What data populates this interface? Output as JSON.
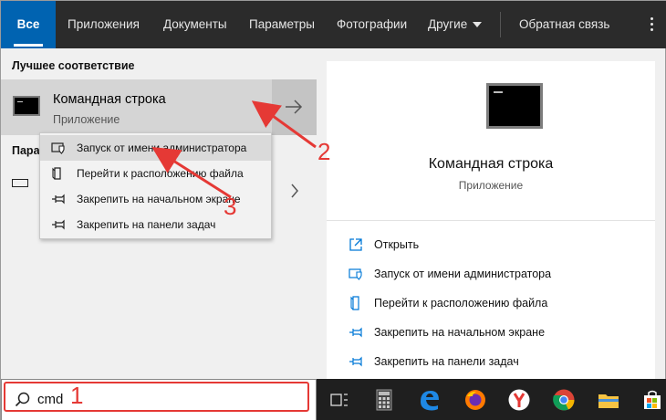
{
  "nav": {
    "tabs": [
      {
        "label": "Все"
      },
      {
        "label": "Приложения"
      },
      {
        "label": "Документы"
      },
      {
        "label": "Параметры"
      },
      {
        "label": "Фотографии"
      },
      {
        "label": "Другие"
      }
    ],
    "feedback": "Обратная связь"
  },
  "best_match": {
    "section_title": "Лучшее соответствие",
    "title": "Командная строка",
    "subtitle": "Приложение"
  },
  "partial_section_title": "Пара",
  "context_menu": {
    "items": [
      {
        "label": "Запуск от имени администратора",
        "icon": "shield-icon"
      },
      {
        "label": "Перейти к расположению файла",
        "icon": "file-location-icon"
      },
      {
        "label": "Закрепить на начальном экране",
        "icon": "pin-icon"
      },
      {
        "label": "Закрепить на панели задач",
        "icon": "pin-icon"
      }
    ]
  },
  "details": {
    "title": "Командная строка",
    "subtitle": "Приложение",
    "actions": [
      {
        "label": "Открыть",
        "icon": "open-icon"
      },
      {
        "label": "Запуск от имени администратора",
        "icon": "shield-icon"
      },
      {
        "label": "Перейти к расположению файла",
        "icon": "file-location-icon"
      },
      {
        "label": "Закрепить на начальном экране",
        "icon": "pin-icon"
      },
      {
        "label": "Закрепить на панели задач",
        "icon": "pin-icon"
      }
    ]
  },
  "search": {
    "value": "cmd"
  },
  "annotations": {
    "n1": "1",
    "n2": "2",
    "n3": "3"
  },
  "colors": {
    "accent": "#0063b1",
    "annotation": "#e53935",
    "icon_blue": "#0078d7"
  }
}
